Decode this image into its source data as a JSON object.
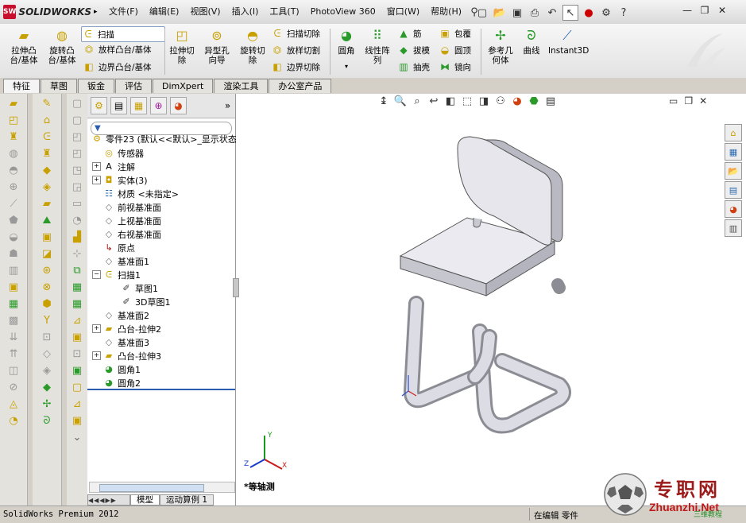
{
  "app": {
    "logo_text": "SOLIDWORKS",
    "logo_badge": "SW"
  },
  "menu": [
    "文件(F)",
    "编辑(E)",
    "视图(V)",
    "插入(I)",
    "工具(T)",
    "PhotoView 360",
    "窗口(W)",
    "帮助(H)"
  ],
  "commands": {
    "extrude_boss": "拉伸凸\n台/基体",
    "revolve_boss": "旋转凸\n台/基体",
    "sweep": "扫描",
    "loft_boss": "放样凸台/基体",
    "boundary_boss": "边界凸台/基体",
    "extrude_cut": "拉伸切\n除",
    "hole_wizard": "异型孔\n向导",
    "revolve_cut": "旋转切\n除",
    "swept_cut": "扫描切除",
    "lofted_cut": "放样切割",
    "boundary_cut": "边界切除",
    "fillet": "圆角",
    "linear_pattern": "线性阵\n列",
    "rib": "筋",
    "draft": "拔模",
    "shell": "抽壳",
    "wrap": "包覆",
    "dome": "圆顶",
    "mirror": "镜向",
    "ref_geometry": "参考几\n何体",
    "curves": "曲线",
    "instant3d": "Instant3D"
  },
  "tabs": [
    "特征",
    "草图",
    "钣金",
    "评估",
    "DimXpert",
    "渲染工具",
    "办公室产品"
  ],
  "tree": {
    "root": "零件23  (默认<<默认>_显示状态",
    "nodes": [
      {
        "label": "传感器",
        "icon": "sensor-icon",
        "expand": ""
      },
      {
        "label": "注解",
        "icon": "annotation-icon",
        "expand": "+"
      },
      {
        "label": "实体(3)",
        "icon": "solid-bodies-icon",
        "expand": "+"
      },
      {
        "label": "材质 <未指定>",
        "icon": "material-icon",
        "expand": ""
      },
      {
        "label": "前视基准面",
        "icon": "plane-icon",
        "expand": ""
      },
      {
        "label": "上视基准面",
        "icon": "plane-icon",
        "expand": ""
      },
      {
        "label": "右视基准面",
        "icon": "plane-icon",
        "expand": ""
      },
      {
        "label": "原点",
        "icon": "origin-icon",
        "expand": ""
      },
      {
        "label": "基准面1",
        "icon": "plane-icon",
        "expand": ""
      },
      {
        "label": "扫描1",
        "icon": "sweep-feature-icon",
        "expand": "−"
      },
      {
        "label": "草图1",
        "icon": "sketch-icon",
        "expand": "",
        "indent": 1
      },
      {
        "label": "3D草图1",
        "icon": "3d-sketch-icon",
        "expand": "",
        "indent": 1
      },
      {
        "label": "基准面2",
        "icon": "plane-icon",
        "expand": ""
      },
      {
        "label": "凸台-拉伸2",
        "icon": "extrude-feature-icon",
        "expand": "+"
      },
      {
        "label": "基准面3",
        "icon": "plane-icon",
        "expand": ""
      },
      {
        "label": "凸台-拉伸3",
        "icon": "extrude-feature-icon",
        "expand": "+"
      },
      {
        "label": "圆角1",
        "icon": "fillet-feature-icon",
        "expand": ""
      },
      {
        "label": "圆角2",
        "icon": "fillet-feature-icon",
        "expand": ""
      }
    ]
  },
  "bottom_tabs": [
    "模型",
    "运动算例 1"
  ],
  "viewport": {
    "view_label": "*等轴测"
  },
  "status": {
    "left": "SolidWorks Premium 2012",
    "right": "在编辑 零件"
  },
  "watermark": {
    "cn": "专职网",
    "en": "Zhuanzhi.Net",
    "sub": "三维教程"
  },
  "colors": {
    "accent_red": "#c8102e",
    "rollback_bar": "#2a5db0",
    "watermark_red": "#c01818"
  }
}
